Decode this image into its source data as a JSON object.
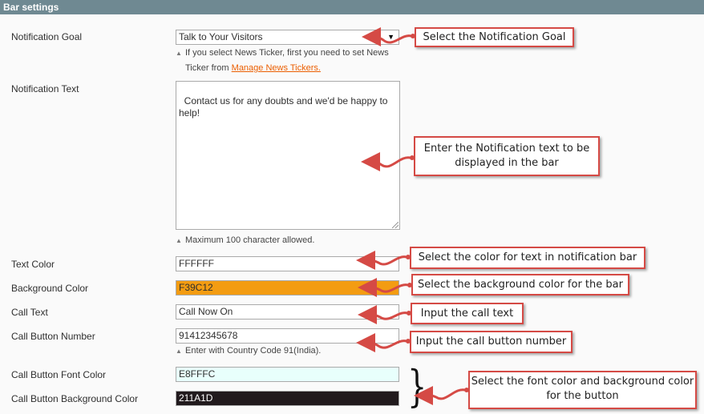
{
  "header": {
    "title": "Bar settings"
  },
  "fields": {
    "notification_goal": {
      "label": "Notification Goal",
      "value": "Talk to Your Visitors",
      "note_text": "If you select News Ticker, first you need to set News",
      "note_text2": "Ticker from",
      "note_link": "Manage News Tickers."
    },
    "notification_text": {
      "label": "Notification Text",
      "value": "Contact us for any doubts and we'd be happy to\nhelp!",
      "note": "Maximum 100 character allowed."
    },
    "text_color": {
      "label": "Text Color",
      "value": "FFFFFF",
      "bg": "#ffffff"
    },
    "background_color": {
      "label": "Background Color",
      "value": "F39C12",
      "bg": "#f39c12"
    },
    "call_text": {
      "label": "Call Text",
      "value": "Call Now On"
    },
    "call_button_number": {
      "label": "Call Button Number",
      "value": "91412345678",
      "note": "Enter with Country Code 91(India)."
    },
    "call_button_font_color": {
      "label": "Call Button Font Color",
      "value": "E8FFFC",
      "bg": "#e8fffc"
    },
    "call_button_background_color": {
      "label": "Call Button Background Color",
      "value": "211A1D",
      "bg": "#211a1d"
    }
  },
  "callouts": {
    "goal": "Select the Notification Goal",
    "text": "Enter the Notification text to be displayed in the bar",
    "text_color": "Select the color for text in notification bar",
    "bg_color": "Select the background color for the bar",
    "call_text": "Input the call text",
    "call_number": "Input the call button number",
    "button_colors": "Select the font color and background color for the button"
  },
  "icons": {
    "dropdown": "chevron-down-icon",
    "note": "triangle-up-icon",
    "brace": "right-brace"
  },
  "colors": {
    "header_bg": "#6f8992",
    "callout_border": "#d54a45",
    "link": "#eb5e00"
  }
}
